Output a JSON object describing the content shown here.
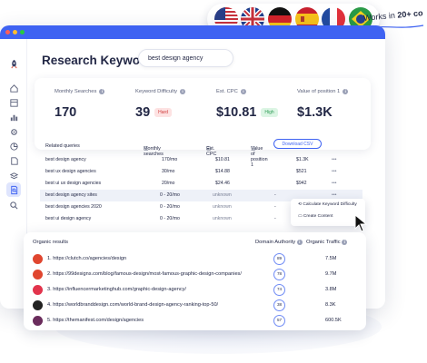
{
  "languages": {
    "flags": [
      "us-flag",
      "uk-flag",
      "germany-flag",
      "spain-flag",
      "france-flag",
      "brazil-flag"
    ],
    "tagline_prefix": "Works in",
    "tagline_strong": "20+ co"
  },
  "window": {
    "title": "Research Keywords",
    "search_value": "best design agency",
    "sidebar_icons": [
      "rocket-icon",
      "home-icon",
      "layout-icon",
      "bar-chart-icon",
      "settings-icon",
      "pie-chart-icon",
      "page-icon",
      "layers-icon",
      "document-search-icon",
      "search-icon"
    ],
    "active_icon_index": 8
  },
  "metrics": [
    {
      "label": "Monthly Searches",
      "value": "170",
      "badge": ""
    },
    {
      "label": "Keyword Difficulty",
      "value": "39",
      "badge": "Hard"
    },
    {
      "label": "Est. CPC",
      "value": "$10.81",
      "badge": "High"
    },
    {
      "label": "Value of position 1",
      "value": "$1.3K",
      "badge": ""
    }
  ],
  "related": {
    "headers": {
      "query": "Related queries",
      "monthly": "Monthly searches",
      "cpc": "Est. CPC",
      "value": "Value of position 1"
    },
    "download_label": "Download CSV",
    "rows": [
      {
        "query": "best design agency",
        "monthly": "170/mo",
        "cpc": "$10.81",
        "value": "$1.3K",
        "more": "•••"
      },
      {
        "query": "best ux design agencies",
        "monthly": "30/mo",
        "cpc": "$14.88",
        "value": "$521",
        "more": "•••"
      },
      {
        "query": "best ui ux design agencies",
        "monthly": "20/mo",
        "cpc": "$24.46",
        "value": "$942",
        "more": "•••"
      },
      {
        "query": "best design agency sites",
        "monthly": "0 - 20/mo",
        "cpc": "unknown",
        "value": "-",
        "more": "•••"
      },
      {
        "query": "best design agencies 2020",
        "monthly": "0 - 20/mo",
        "cpc": "unknown",
        "value": "-",
        "more": ""
      },
      {
        "query": "best ui design agency",
        "monthly": "0 - 20/mo",
        "cpc": "unknown",
        "value": "-",
        "more": ""
      }
    ],
    "menu": [
      "Calculate Keyword Difficulty",
      "Create Content"
    ]
  },
  "organic": {
    "title": "Organic results",
    "da_header": "Domain Authority",
    "traffic_header": "Organic Traffic",
    "rows": [
      {
        "url": "1. https://clutch.co/agencies/design",
        "da": "89",
        "traffic": "7.5M",
        "fav_color": "#e0462f"
      },
      {
        "url": "2. https://99designs.com/blog/famous-design/most-famous-graphic-design-companies/",
        "da": "78",
        "traffic": "9.7M",
        "fav_color": "#e0462f"
      },
      {
        "url": "3. https://influencermarketinghub.com/graphic-design-agency/",
        "da": "74",
        "traffic": "3.8M",
        "fav_color": "#e2344c"
      },
      {
        "url": "4. https://worldbranddesign.com/world-brand-design-agency-ranking-top-50/",
        "da": "38",
        "traffic": "8.3K",
        "fav_color": "#222222"
      },
      {
        "url": "5. https://themanifest.com/design/agencies",
        "da": "57",
        "traffic": "600.5K",
        "fav_color": "#6a2c5c"
      }
    ]
  },
  "colors": {
    "accent": "#3f63f2",
    "hard": "#d03a3a",
    "high": "#2f9c56"
  }
}
